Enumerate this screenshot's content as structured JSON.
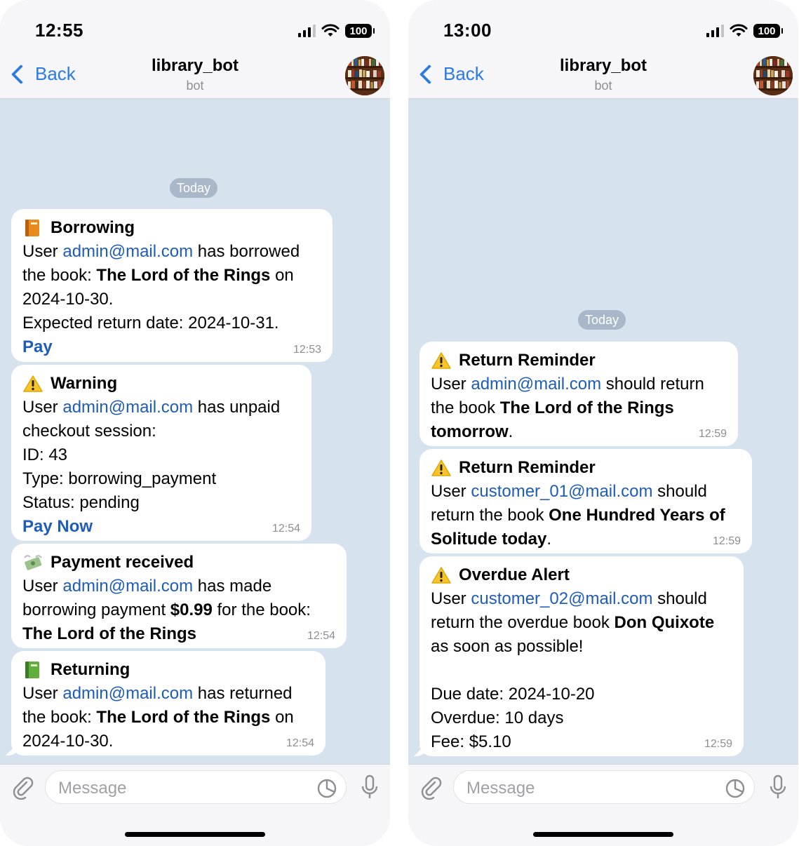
{
  "left": {
    "status_time": "12:55",
    "battery": "100",
    "back_label": "Back",
    "chat_title": "library_bot",
    "chat_subtitle": "bot",
    "day_label": "Today",
    "messages": [
      {
        "icon": "orange-book-icon",
        "header": "Borrowing",
        "lines": [
          "User ",
          "admin@mail.com",
          " has borrowed the book: ",
          "The Lord of the Rings",
          " on 2024-10-30.",
          "Expected return date: 2024-10-31."
        ],
        "action": "Pay",
        "time": "12:53"
      },
      {
        "icon": "warning-icon",
        "header": "Warning",
        "user_prefix": "User ",
        "email": "admin@mail.com",
        "text": " has unpaid checkout session:",
        "id_line": "ID: 43",
        "type_line": "Type: borrowing_payment",
        "status_line": "Status: pending",
        "action": "Pay Now",
        "time": "12:54"
      },
      {
        "icon": "money-with-wings-icon",
        "header": "Payment received",
        "user_prefix": "User ",
        "email": "admin@mail.com",
        "text1": " has made borrowing payment ",
        "amount": "$0.99",
        "text2": " for the book:",
        "book": "The Lord of the Rings",
        "time": "12:54"
      },
      {
        "icon": "green-book-icon",
        "header": "Returning",
        "user_prefix": "User ",
        "email": "admin@mail.com",
        "text1": " has returned the book: ",
        "book": "The Lord of the Rings",
        "text2": " on 2024-10-30.",
        "time": "12:54"
      }
    ],
    "input_placeholder": "Message"
  },
  "right": {
    "status_time": "13:00",
    "battery": "100",
    "back_label": "Back",
    "chat_title": "library_bot",
    "chat_subtitle": "bot",
    "day_label": "Today",
    "messages": [
      {
        "icon": "warning-icon",
        "header": "Return Reminder",
        "user_prefix": "User ",
        "email": "admin@mail.com",
        "text1": " should return the book ",
        "book": "The Lord of the Rings tomorrow",
        "text2": ".",
        "time": "12:59"
      },
      {
        "icon": "warning-icon",
        "header": "Return Reminder",
        "user_prefix": "User ",
        "email": "customer_01@mail.com",
        "text1": " should return the book ",
        "book": "One Hundred Years of Solitude today",
        "text2": ".",
        "time": "12:59"
      },
      {
        "icon": "warning-icon",
        "header": "Overdue Alert",
        "user_prefix": "User ",
        "email": "customer_02@mail.com",
        "text1": " should return the overdue book ",
        "book": "Don Quixote",
        "text2": " as soon as possible!",
        "due_line": "Due date: 2024-10-20",
        "overdue_line": "Overdue: 10 days",
        "fee_line": "Fee: $5.10",
        "time": "12:59"
      }
    ],
    "input_placeholder": "Message"
  },
  "colors": {
    "accent": "#2a7ae4",
    "link": "#1e5cba",
    "chat_background": "#d6e2ee",
    "bubble": "#ffffff"
  }
}
